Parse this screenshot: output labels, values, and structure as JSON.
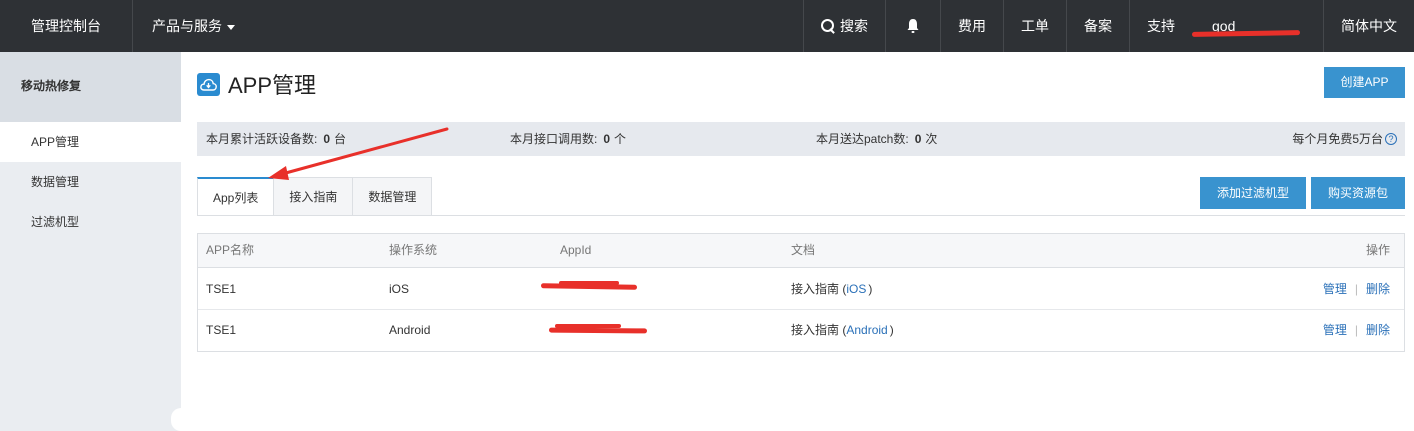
{
  "topbar": {
    "brand": "管理控制台",
    "products": "产品与服务",
    "search": "搜索",
    "billing": "费用",
    "ticket": "工单",
    "filing": "备案",
    "support": "支持",
    "user": "god",
    "language": "简体中文"
  },
  "sidebar": {
    "title": "移动热修复",
    "items": [
      {
        "label": "APP管理"
      },
      {
        "label": "数据管理"
      },
      {
        "label": "过滤机型"
      }
    ]
  },
  "page": {
    "title": "APP管理",
    "create_button": "创建APP",
    "add_filter_button": "添加过滤机型",
    "buy_button": "购买资源包"
  },
  "stats": {
    "devices_label": "本月累计活跃设备数:",
    "devices_value": "0",
    "devices_unit": "台",
    "api_label": "本月接口调用数:",
    "api_value": "0",
    "api_unit": "个",
    "patch_label": "本月送达patch数:",
    "patch_value": "0",
    "patch_unit": "次",
    "free_note": "每个月免费5万台"
  },
  "tabs": [
    {
      "label": "App列表"
    },
    {
      "label": "接入指南"
    },
    {
      "label": "数据管理"
    }
  ],
  "table": {
    "headers": [
      "APP名称",
      "操作系统",
      "AppId",
      "文档",
      "操作"
    ],
    "rows": [
      {
        "name": "TSE1",
        "os": "iOS",
        "doc_prefix": "接入指南 (",
        "doc_link": "iOS",
        "doc_suffix": ")",
        "manage": "管理",
        "delete": "删除"
      },
      {
        "name": "TSE1",
        "os": "Android",
        "doc_prefix": "接入指南 (",
        "doc_link": "Android",
        "doc_suffix": ")",
        "manage": "管理",
        "delete": "删除"
      }
    ],
    "separator": "|"
  },
  "colors": {
    "topbar_bg": "#2e3135",
    "accent_blue": "#3993cf",
    "link_blue": "#2a70b8",
    "annotation_red": "#e8302a"
  }
}
